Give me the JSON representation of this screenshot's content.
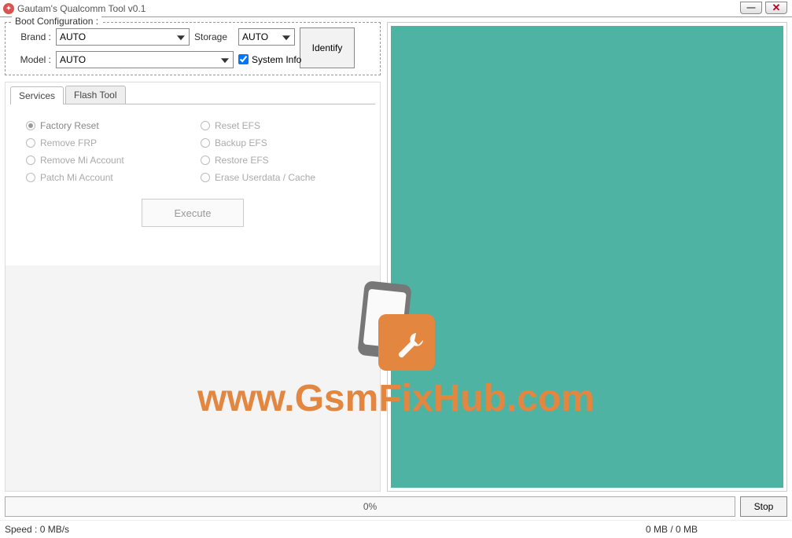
{
  "window": {
    "title": "Gautam's Qualcomm Tool v0.1"
  },
  "boot": {
    "legend": "Boot Configuration :",
    "brand_label": "Brand :",
    "brand_value": "AUTO",
    "storage_label": "Storage",
    "storage_value": "AUTO",
    "model_label": "Model :",
    "model_value": "AUTO",
    "sysinfo_label": "System Info",
    "identify_label": "Identify"
  },
  "tabs": {
    "services_label": "Services",
    "flash_label": "Flash Tool"
  },
  "services": {
    "options": [
      "Factory Reset",
      "Reset EFS",
      "Remove FRP",
      "Backup EFS",
      "Remove Mi Account",
      "Restore EFS",
      "Patch Mi Account",
      "Erase Userdata / Cache"
    ],
    "selected_index": 0,
    "execute_label": "Execute"
  },
  "progress": {
    "text": "0%",
    "stop_label": "Stop"
  },
  "status": {
    "speed": "Speed : 0 MB/s",
    "bytes": "0 MB / 0 MB"
  },
  "watermark": {
    "text": "www.GsmFixHub.com"
  }
}
